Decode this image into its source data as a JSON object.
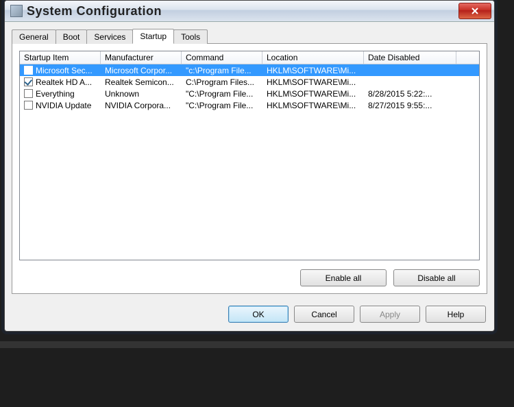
{
  "window": {
    "title": "System Configuration"
  },
  "tabs": {
    "general": "General",
    "boot": "Boot",
    "services": "Services",
    "startup": "Startup",
    "tools": "Tools"
  },
  "columns": {
    "startup_item": "Startup Item",
    "manufacturer": "Manufacturer",
    "command": "Command",
    "location": "Location",
    "date_disabled": "Date Disabled"
  },
  "rows": [
    {
      "checked": true,
      "selected": true,
      "item": "Microsoft Sec...",
      "mfr": "Microsoft Corpor...",
      "cmd": "\"c:\\Program File...",
      "loc": "HKLM\\SOFTWARE\\Mi...",
      "date": ""
    },
    {
      "checked": true,
      "selected": false,
      "item": "Realtek HD A...",
      "mfr": "Realtek Semicon...",
      "cmd": "C:\\Program Files...",
      "loc": "HKLM\\SOFTWARE\\Mi...",
      "date": ""
    },
    {
      "checked": false,
      "selected": false,
      "item": "Everything",
      "mfr": "Unknown",
      "cmd": "\"C:\\Program File...",
      "loc": "HKLM\\SOFTWARE\\Mi...",
      "date": "8/28/2015 5:22:..."
    },
    {
      "checked": false,
      "selected": false,
      "item": "NVIDIA Update",
      "mfr": "NVIDIA Corpora...",
      "cmd": "\"C:\\Program File...",
      "loc": "HKLM\\SOFTWARE\\Mi...",
      "date": "8/27/2015 9:55:..."
    }
  ],
  "panel_buttons": {
    "enable_all": "Enable all",
    "disable_all": "Disable all"
  },
  "dialog_buttons": {
    "ok": "OK",
    "cancel": "Cancel",
    "apply": "Apply",
    "help": "Help"
  }
}
